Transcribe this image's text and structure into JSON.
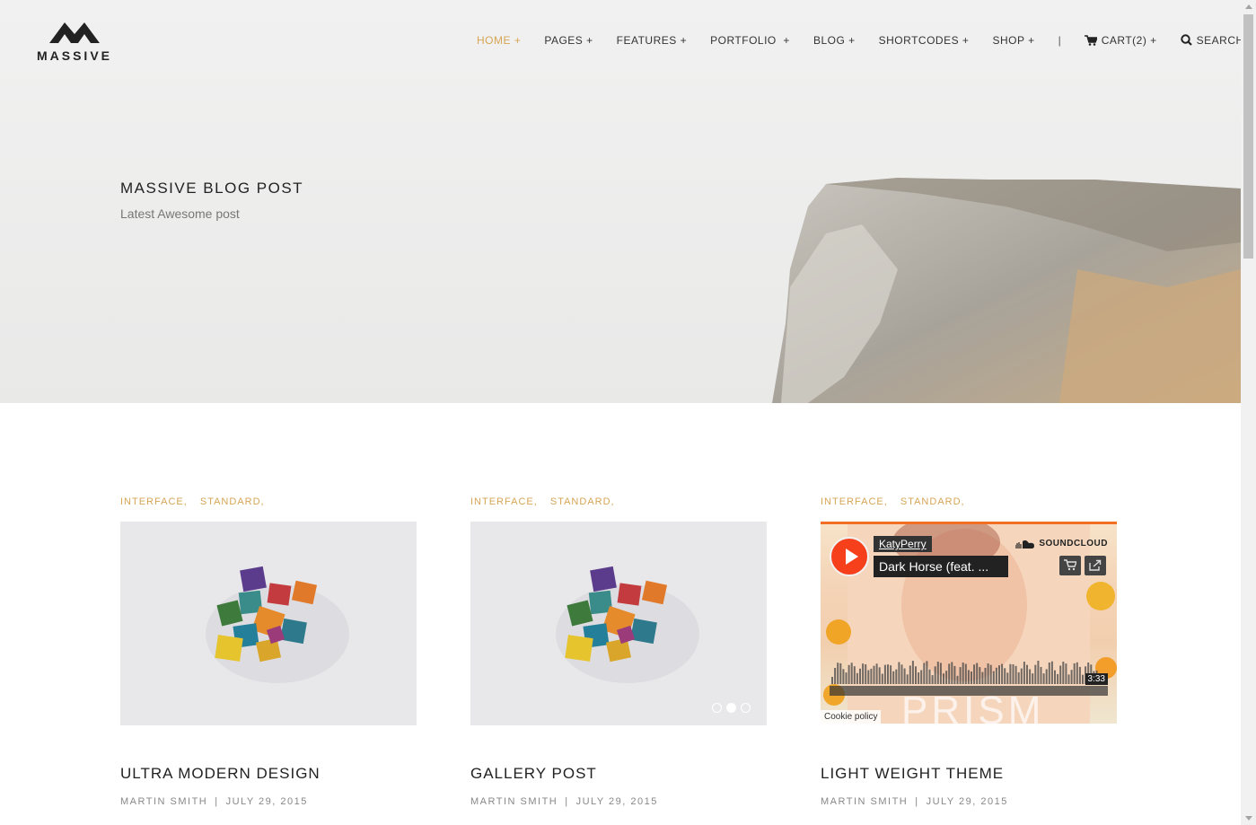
{
  "brand": {
    "name": "MASSIVE"
  },
  "nav": {
    "items": [
      {
        "label": "HOME +",
        "active": true
      },
      {
        "label": "PAGES +"
      },
      {
        "label": "FEATURES +"
      },
      {
        "label": "PORTFOLIO  +"
      },
      {
        "label": "BLOG +"
      },
      {
        "label": "SHORTCODES +"
      },
      {
        "label": "SHOP +"
      }
    ],
    "separator": "|",
    "cart_label": "CART(2) +",
    "search_label": "SEARCH +",
    "accent_color": "#d6a555"
  },
  "hero": {
    "title": "MASSIVE BLOG POST",
    "subtitle": "Latest Awesome post"
  },
  "posts": [
    {
      "tags": [
        "INTERFACE,",
        "STANDARD,"
      ],
      "title": "ULTRA MODERN DESIGN",
      "author": "MARTIN SMITH",
      "date": "JULY 29, 2015",
      "media": "image"
    },
    {
      "tags": [
        "INTERFACE,",
        "STANDARD,"
      ],
      "title": "GALLERY POST",
      "author": "MARTIN SMITH",
      "date": "JULY 29, 2015",
      "media": "gallery",
      "gallery_active_slide": 2,
      "gallery_slide_count": 3
    },
    {
      "tags": [
        "INTERFACE,",
        "STANDARD,"
      ],
      "title": "LIGHT WEIGHT THEME",
      "author": "MARTIN SMITH",
      "date": "JULY 29, 2015",
      "media": "soundcloud",
      "player": {
        "user": "KatyPerry",
        "track": "Dark Horse (feat. ...",
        "brand": "SOUNDCLOUD",
        "duration": "3:33",
        "cookie": "Cookie policy"
      }
    }
  ],
  "meta_separator": "|"
}
